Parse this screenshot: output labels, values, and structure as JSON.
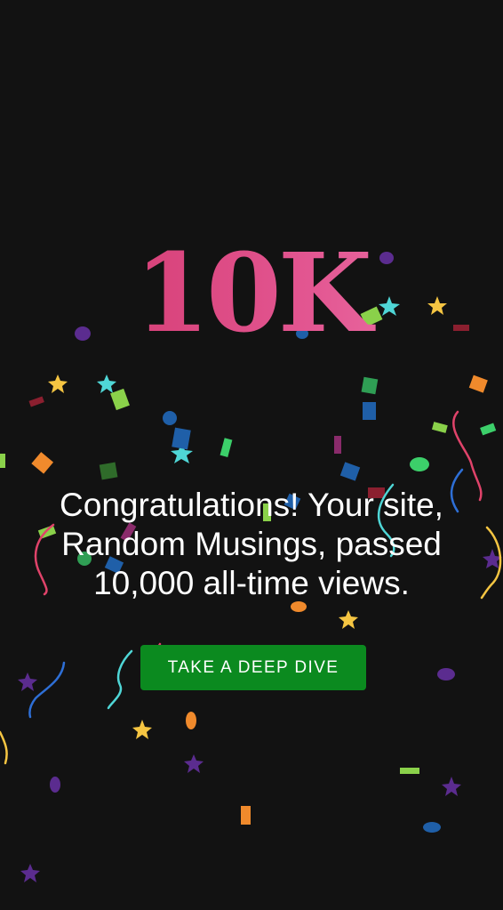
{
  "celebration": {
    "milestone": "10K",
    "message": "Congratulations! Your site, Random Musings, passed 10,000 all-time views.",
    "cta_label": "TAKE A DEEP DIVE"
  },
  "colors": {
    "background": "#121212",
    "milestone_gradient": [
      "#cf3267",
      "#f07aaf"
    ],
    "cta_background": "#0b8a1f",
    "text": "#ffffff",
    "confetti": [
      "#f5c542",
      "#4fd6d6",
      "#8ad14a",
      "#f08a2c",
      "#5b2c8f",
      "#2e6fd6",
      "#e0436a",
      "#8a2b6b",
      "#2f9e54",
      "#1f5fa8",
      "#8b1f2f"
    ]
  },
  "icons": {
    "confetti": "confetti-pieces"
  }
}
